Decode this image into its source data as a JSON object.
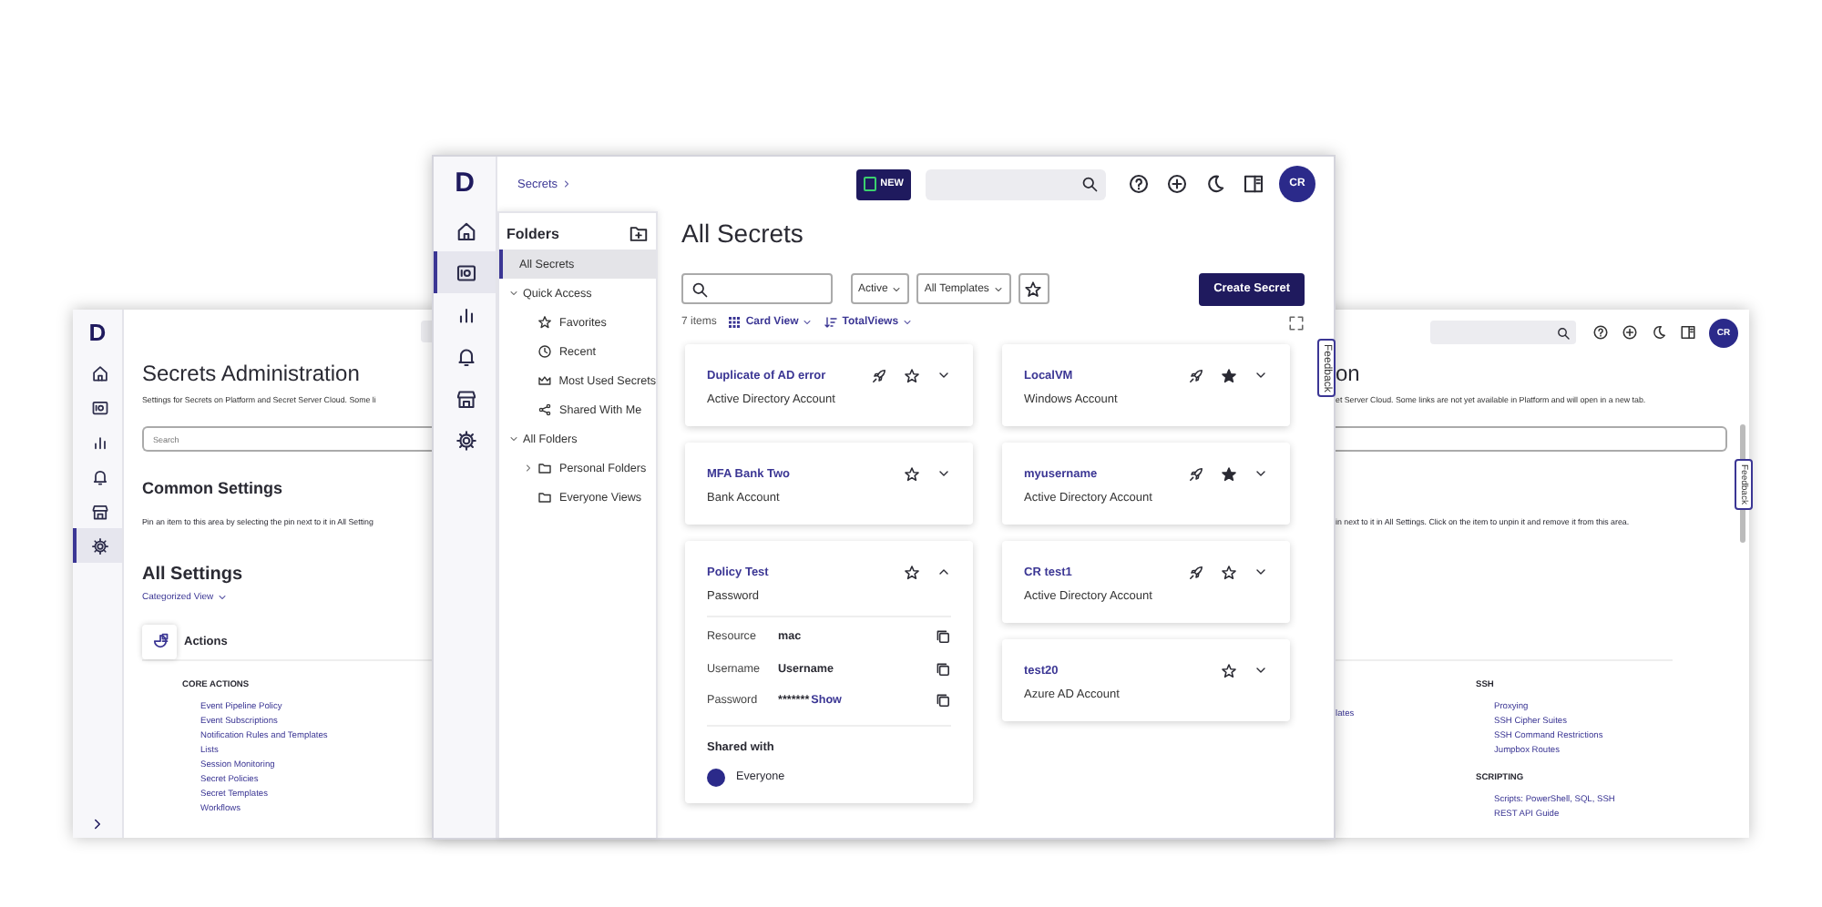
{
  "admin_window": {
    "sidebar": {
      "logo": "D",
      "items": [
        {
          "kind": "home",
          "selected": false
        },
        {
          "kind": "vault",
          "selected": false
        },
        {
          "kind": "chart",
          "selected": false
        },
        {
          "kind": "bell",
          "selected": false
        },
        {
          "kind": "store",
          "selected": false
        },
        {
          "kind": "gear",
          "selected": true
        }
      ]
    },
    "left_part": {
      "title": "Secrets Administration",
      "description": "Settings for Secrets on Platform and Secret Server Cloud. Some li",
      "search": {
        "placeholder": "Search"
      },
      "common_heading": "Common Settings",
      "pin_hint": "Pin an item to this area by selecting the pin next to it in All Setting",
      "all_heading": "All Settings",
      "view_menu": "Categorized View",
      "category": "Actions",
      "groups": [
        {
          "heading": "CORE ACTIONS",
          "links": [
            "Event Pipeline Policy",
            "Event Subscriptions",
            "Notification Rules and Templates",
            "Lists",
            "Session Monitoring",
            "Secret Policies",
            "Secret Templates",
            "Workflows"
          ]
        }
      ]
    },
    "right_part": {
      "avatar": "CR",
      "title": "on",
      "description": "et Server Cloud. Some links are not yet available in Platform and will open in a new tab.",
      "pin_hint": "in next to it in All Settings. Click on the item to unpin it and remove it from this area.",
      "feedback": "Feedback",
      "link_fragment": "lates",
      "groups": [
        {
          "heading": "SSH",
          "links": [
            "Proxying",
            "SSH Cipher Suites",
            "SSH Command Restrictions",
            "Jumpbox Routes"
          ]
        },
        {
          "heading": "SCRIPTING",
          "links": [
            "Scripts: PowerShell, SQL, SSH",
            "REST API Guide"
          ]
        }
      ]
    }
  },
  "secrets_window": {
    "sidebar": {
      "logo": "D",
      "items": [
        {
          "kind": "home",
          "selected": false
        },
        {
          "kind": "vault",
          "selected": true
        },
        {
          "kind": "chart",
          "selected": false
        },
        {
          "kind": "bell",
          "selected": false
        },
        {
          "kind": "store",
          "selected": false
        },
        {
          "kind": "gear",
          "selected": false
        }
      ]
    },
    "breadcrumb": "Secrets",
    "new_button": "NEW",
    "avatar": "CR",
    "folders": {
      "title": "Folders",
      "items": [
        {
          "label": "All Secrets",
          "selected": true
        },
        {
          "label": "Quick Access",
          "expanded": true,
          "selected": false,
          "children": [
            {
              "label": "Favorites",
              "kind": "star",
              "selected": false
            },
            {
              "label": "Recent",
              "kind": "clock",
              "selected": false
            },
            {
              "label": "Most Used Secrets",
              "kind": "crown",
              "selected": false
            },
            {
              "label": "Shared With Me",
              "kind": "share",
              "selected": false
            }
          ]
        },
        {
          "label": "All Folders",
          "expanded": true,
          "selected": false,
          "children": [
            {
              "label": "Personal Folders",
              "kind": "folder",
              "expanded": false,
              "selected": false
            },
            {
              "label": "Everyone Views",
              "kind": "folder",
              "selected": false
            }
          ]
        }
      ]
    },
    "title": "All Secrets",
    "filters": {
      "status": "Active",
      "template": "All Templates"
    },
    "create_button": "Create Secret",
    "toolbar": {
      "count": "7 items",
      "view": "Card View",
      "sort": "TotalViews"
    },
    "feedback": "Feedback",
    "card_columns": [
      {
        "cards": [
          {
            "title": "Duplicate of AD error",
            "type": "Active Directory Account",
            "launcher": true,
            "starred": false,
            "expanded": false
          },
          {
            "title": "MFA Bank Two",
            "type": "Bank Account",
            "launcher": false,
            "starred": false,
            "expanded": false
          },
          {
            "title": "Policy Test",
            "type": "Password",
            "launcher": false,
            "starred": false,
            "expanded": true,
            "details": [
              {
                "label": "Resource",
                "value": "mac"
              },
              {
                "label": "Username",
                "value": "Username"
              },
              {
                "label": "Password",
                "value": "*******",
                "action": "Show"
              }
            ],
            "shared_heading": "Shared with",
            "shared": [
              "Everyone"
            ]
          }
        ]
      },
      {
        "cards": [
          {
            "title": "LocalVM",
            "type": "Windows Account",
            "launcher": true,
            "starred": true,
            "expanded": false
          },
          {
            "title": "myusername",
            "type": "Active Directory Account",
            "launcher": true,
            "starred": true,
            "expanded": false
          },
          {
            "title": "CR test1",
            "type": "Active Directory Account",
            "launcher": true,
            "starred": false,
            "expanded": false
          },
          {
            "title": "test20",
            "type": "Azure AD Account",
            "launcher": false,
            "starred": false,
            "expanded": false
          }
        ]
      }
    ]
  }
}
